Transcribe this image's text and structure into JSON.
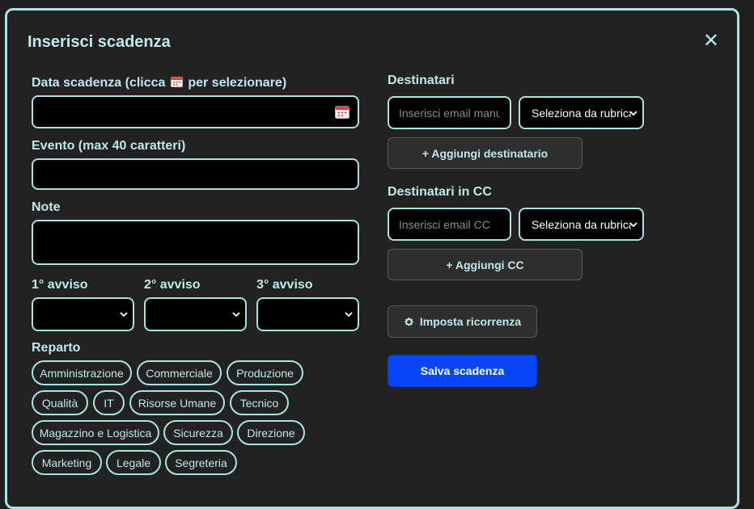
{
  "modal": {
    "title": "Inserisci scadenza",
    "close_glyph": "✕"
  },
  "form": {
    "date_label_pre": "Data scadenza (clicca",
    "date_label_post": "per selezionare)",
    "date_value": "",
    "event_label": "Evento (max 40 caratteri)",
    "event_value": "",
    "notes_label": "Note",
    "notes_value": "",
    "reminders": [
      {
        "label": "1° avviso",
        "value": ""
      },
      {
        "label": "2° avviso",
        "value": ""
      },
      {
        "label": "3° avviso",
        "value": ""
      }
    ],
    "department_label": "Reparto",
    "departments": [
      "Amministrazione",
      "Commerciale",
      "Produzione",
      "Qualità",
      "IT",
      "Risorse Umane",
      "Tecnico",
      "Magazzino e Logistica",
      "Sicurezza",
      "Direzione",
      "Marketing",
      "Legale",
      "Segreteria"
    ]
  },
  "recipients": {
    "label": "Destinatari",
    "email_placeholder": "Inserisci email manuale",
    "addressbook_value": "Seleziona da rubrica",
    "add_label": "+ Aggiungi destinatario"
  },
  "cc": {
    "label": "Destinatari in CC",
    "email_placeholder": "Inserisci email CC",
    "addressbook_value": "Seleziona da rubrica",
    "add_label": "+ Aggiungi CC"
  },
  "actions": {
    "recurrence_label": "Imposta ricorrenza",
    "save_label": "Salva scadenza"
  },
  "colors": {
    "accent": "#a9e3e3",
    "primary": "#0646f8",
    "background": "#222222"
  },
  "icons": [
    "calendar-icon",
    "close-icon",
    "gear-icon",
    "chevron-down-icon"
  ]
}
